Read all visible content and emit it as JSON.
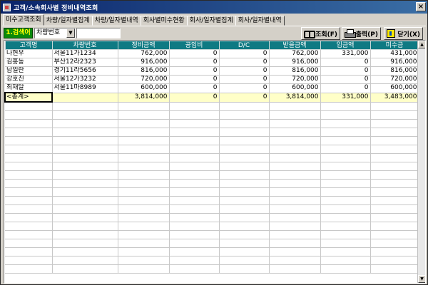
{
  "window": {
    "title": "고객/소속회사별 정비내역조회",
    "close_glyph": "×"
  },
  "tabs": [
    {
      "label": "미수고객조회",
      "active": true
    },
    {
      "label": "차량/일자별집계",
      "active": false
    },
    {
      "label": "차량/일자별내역",
      "active": false
    },
    {
      "label": "회사별미수현황",
      "active": false
    },
    {
      "label": "회사/일자별집계",
      "active": false
    },
    {
      "label": "회사/일자별내역",
      "active": false
    }
  ],
  "toolbar": {
    "search_label": "1.검색어",
    "search_field": "차량번호",
    "search_value": "",
    "query_label": "조회(F)",
    "print_label": "출력(P)",
    "close_label": "닫기(X)"
  },
  "grid": {
    "columns": [
      "고객명",
      "차량번호",
      "정비금액",
      "공임비",
      "D/C",
      "받을금액",
      "입금액",
      "미수금"
    ],
    "rows": [
      [
        "나현우",
        "서울11가1234",
        "762,000",
        "0",
        "0",
        "762,000",
        "331,000",
        "431,000"
      ],
      [
        "김홍동",
        "부산12라2323",
        "916,000",
        "0",
        "0",
        "916,000",
        "0",
        "916,000"
      ],
      [
        "남일란",
        "경기11라5656",
        "816,000",
        "0",
        "0",
        "816,000",
        "0",
        "816,000"
      ],
      [
        "강호진",
        "서울12가3232",
        "720,000",
        "0",
        "0",
        "720,000",
        "0",
        "720,000"
      ],
      [
        "최재달",
        "서울11마8989",
        "600,000",
        "0",
        "0",
        "600,000",
        "0",
        "600,000"
      ]
    ],
    "total": [
      "<총계>",
      "",
      "3,814,000",
      "0",
      "0",
      "3,814,000",
      "331,000",
      "3,483,000"
    ]
  },
  "colors": {
    "title_bar": "#0a246a",
    "header": "#0f7a83",
    "total_row": "#ffffc8",
    "search_label_bg": "#0a8a0a"
  },
  "icons": {
    "query": "binoculars-icon",
    "print": "printer-icon",
    "close": "exit-door-icon"
  }
}
